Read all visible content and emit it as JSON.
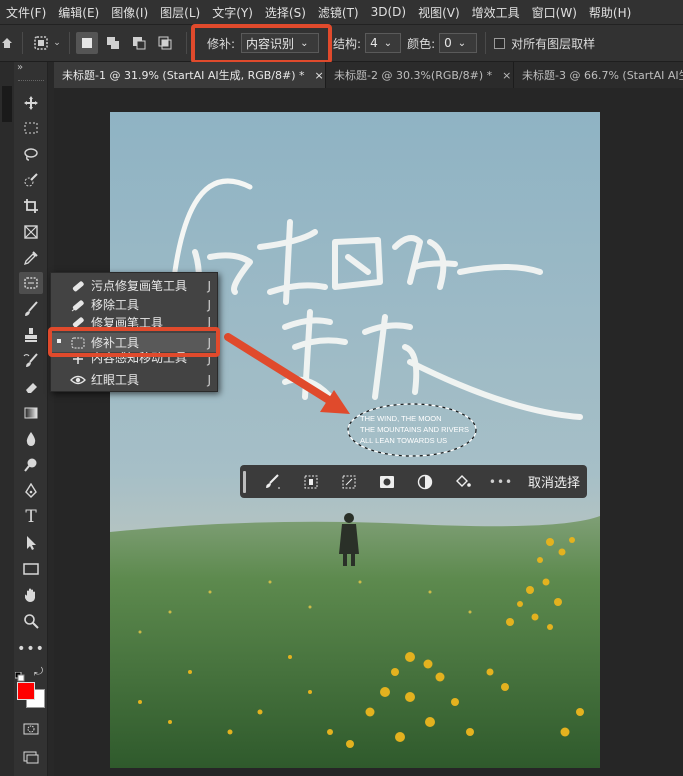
{
  "menu": [
    "文件(F)",
    "编辑(E)",
    "图像(I)",
    "图层(L)",
    "文字(Y)",
    "选择(S)",
    "滤镜(T)",
    "3D(D)",
    "视图(V)",
    "增效工具",
    "窗口(W)",
    "帮助(H)"
  ],
  "options": {
    "patch_label": "修补:",
    "patch_value": "内容识别",
    "structure_label": "结构:",
    "structure_value": "4",
    "color_label": "颜色:",
    "color_value": "0",
    "sample_all_label": "对所有图层取样"
  },
  "tabs": [
    {
      "label": "未标题-1 @ 31.9% (StartAI AI生成, RGB/8#) *",
      "close": "×"
    },
    {
      "label": "未标题-2 @ 30.3%(RGB/8#) *",
      "close": "×"
    },
    {
      "label": "未标题-3 @ 66.7% (StartAI AI生成",
      "close": ""
    }
  ],
  "flyout": [
    {
      "label": "污点修复画笔工具",
      "key": "J",
      "icon": "spot-healing-brush-icon"
    },
    {
      "label": "移除工具",
      "key": "J",
      "icon": "remove-tool-icon"
    },
    {
      "label": "修复画笔工具",
      "key": "J",
      "icon": "healing-brush-icon"
    },
    {
      "label": "修补工具",
      "key": "J",
      "icon": "patch-tool-icon",
      "selected": true
    },
    {
      "label": "内容感知移动工具",
      "key": "J",
      "icon": "content-aware-move-icon"
    },
    {
      "label": "红眼工具",
      "key": "J",
      "icon": "red-eye-icon"
    }
  ],
  "canvas_text": {
    "calligraphy": "时光因你柔软",
    "english_lines": [
      "THE WIND, THE MOON",
      "THE MOUNTAINS AND RIVERS",
      "ALL LEAN TOWARDS US"
    ]
  },
  "context_bar": {
    "deselect_label": "取消选择"
  },
  "colors": {
    "accent": "#e04a2c",
    "foreground": "#ff0000",
    "background": "#ffffff",
    "sky": "#8fb3c4",
    "grass": "#3f6b3a"
  }
}
